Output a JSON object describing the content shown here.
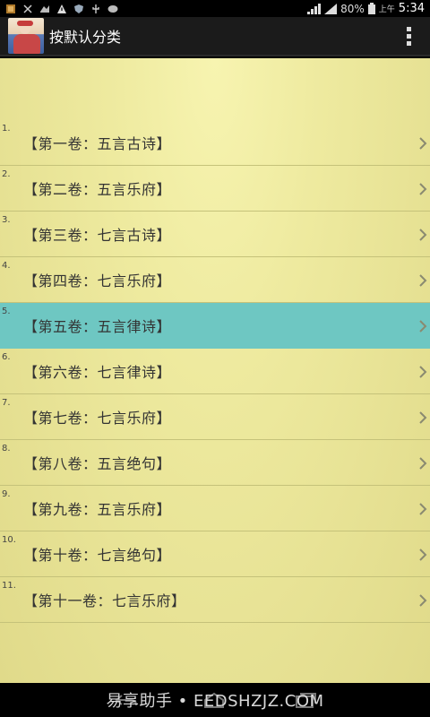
{
  "statusbar": {
    "battery": "80%",
    "ampm": "上午",
    "time": "5:34",
    "icons": [
      "app-icon",
      "usb-icon",
      "debug-icon",
      "warning-icon",
      "shield-icon",
      "usb-plug-icon",
      "chat-icon"
    ]
  },
  "actionbar": {
    "title": "按默认分类",
    "menu_icon": "overflow-menu-icon"
  },
  "list": {
    "selected_index": 4,
    "items": [
      {
        "num": "1.",
        "label": "【第一卷：五言古诗】"
      },
      {
        "num": "2.",
        "label": "【第二卷：五言乐府】"
      },
      {
        "num": "3.",
        "label": "【第三卷：七言古诗】"
      },
      {
        "num": "4.",
        "label": "【第四卷：七言乐府】"
      },
      {
        "num": "5.",
        "label": "【第五卷：五言律诗】"
      },
      {
        "num": "6.",
        "label": "【第六卷：七言律诗】"
      },
      {
        "num": "7.",
        "label": "【第七卷：七言乐府】"
      },
      {
        "num": "8.",
        "label": "【第八卷：五言绝句】"
      },
      {
        "num": "9.",
        "label": "【第九卷：五言乐府】"
      },
      {
        "num": "10.",
        "label": "【第十卷：七言绝句】"
      },
      {
        "num": "11.",
        "label": "【第十一卷：七言乐府】"
      }
    ]
  },
  "navbar": {
    "watermark": "易享助手 • EEDSHZJZ.COM"
  },
  "colors": {
    "selected_row": "#6ec7c2",
    "content_bg": "#eeea9f"
  }
}
